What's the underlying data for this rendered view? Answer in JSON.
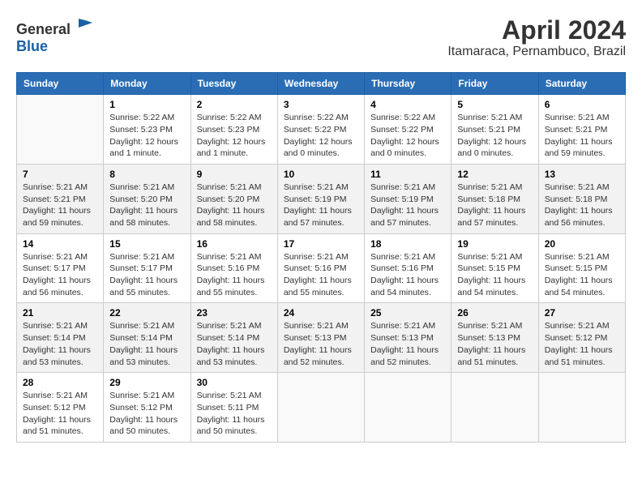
{
  "logo": {
    "general": "General",
    "blue": "Blue"
  },
  "title": "April 2024",
  "subtitle": "Itamaraca, Pernambuco, Brazil",
  "calendar": {
    "headers": [
      "Sunday",
      "Monday",
      "Tuesday",
      "Wednesday",
      "Thursday",
      "Friday",
      "Saturday"
    ],
    "weeks": [
      [
        {
          "day": "",
          "detail": ""
        },
        {
          "day": "1",
          "detail": "Sunrise: 5:22 AM\nSunset: 5:23 PM\nDaylight: 12 hours\nand 1 minute."
        },
        {
          "day": "2",
          "detail": "Sunrise: 5:22 AM\nSunset: 5:23 PM\nDaylight: 12 hours\nand 1 minute."
        },
        {
          "day": "3",
          "detail": "Sunrise: 5:22 AM\nSunset: 5:22 PM\nDaylight: 12 hours\nand 0 minutes."
        },
        {
          "day": "4",
          "detail": "Sunrise: 5:22 AM\nSunset: 5:22 PM\nDaylight: 12 hours\nand 0 minutes."
        },
        {
          "day": "5",
          "detail": "Sunrise: 5:21 AM\nSunset: 5:21 PM\nDaylight: 12 hours\nand 0 minutes."
        },
        {
          "day": "6",
          "detail": "Sunrise: 5:21 AM\nSunset: 5:21 PM\nDaylight: 11 hours\nand 59 minutes."
        }
      ],
      [
        {
          "day": "7",
          "detail": "Sunrise: 5:21 AM\nSunset: 5:21 PM\nDaylight: 11 hours\nand 59 minutes."
        },
        {
          "day": "8",
          "detail": "Sunrise: 5:21 AM\nSunset: 5:20 PM\nDaylight: 11 hours\nand 58 minutes."
        },
        {
          "day": "9",
          "detail": "Sunrise: 5:21 AM\nSunset: 5:20 PM\nDaylight: 11 hours\nand 58 minutes."
        },
        {
          "day": "10",
          "detail": "Sunrise: 5:21 AM\nSunset: 5:19 PM\nDaylight: 11 hours\nand 57 minutes."
        },
        {
          "day": "11",
          "detail": "Sunrise: 5:21 AM\nSunset: 5:19 PM\nDaylight: 11 hours\nand 57 minutes."
        },
        {
          "day": "12",
          "detail": "Sunrise: 5:21 AM\nSunset: 5:18 PM\nDaylight: 11 hours\nand 57 minutes."
        },
        {
          "day": "13",
          "detail": "Sunrise: 5:21 AM\nSunset: 5:18 PM\nDaylight: 11 hours\nand 56 minutes."
        }
      ],
      [
        {
          "day": "14",
          "detail": "Sunrise: 5:21 AM\nSunset: 5:17 PM\nDaylight: 11 hours\nand 56 minutes."
        },
        {
          "day": "15",
          "detail": "Sunrise: 5:21 AM\nSunset: 5:17 PM\nDaylight: 11 hours\nand 55 minutes."
        },
        {
          "day": "16",
          "detail": "Sunrise: 5:21 AM\nSunset: 5:16 PM\nDaylight: 11 hours\nand 55 minutes."
        },
        {
          "day": "17",
          "detail": "Sunrise: 5:21 AM\nSunset: 5:16 PM\nDaylight: 11 hours\nand 55 minutes."
        },
        {
          "day": "18",
          "detail": "Sunrise: 5:21 AM\nSunset: 5:16 PM\nDaylight: 11 hours\nand 54 minutes."
        },
        {
          "day": "19",
          "detail": "Sunrise: 5:21 AM\nSunset: 5:15 PM\nDaylight: 11 hours\nand 54 minutes."
        },
        {
          "day": "20",
          "detail": "Sunrise: 5:21 AM\nSunset: 5:15 PM\nDaylight: 11 hours\nand 54 minutes."
        }
      ],
      [
        {
          "day": "21",
          "detail": "Sunrise: 5:21 AM\nSunset: 5:14 PM\nDaylight: 11 hours\nand 53 minutes."
        },
        {
          "day": "22",
          "detail": "Sunrise: 5:21 AM\nSunset: 5:14 PM\nDaylight: 11 hours\nand 53 minutes."
        },
        {
          "day": "23",
          "detail": "Sunrise: 5:21 AM\nSunset: 5:14 PM\nDaylight: 11 hours\nand 53 minutes."
        },
        {
          "day": "24",
          "detail": "Sunrise: 5:21 AM\nSunset: 5:13 PM\nDaylight: 11 hours\nand 52 minutes."
        },
        {
          "day": "25",
          "detail": "Sunrise: 5:21 AM\nSunset: 5:13 PM\nDaylight: 11 hours\nand 52 minutes."
        },
        {
          "day": "26",
          "detail": "Sunrise: 5:21 AM\nSunset: 5:13 PM\nDaylight: 11 hours\nand 51 minutes."
        },
        {
          "day": "27",
          "detail": "Sunrise: 5:21 AM\nSunset: 5:12 PM\nDaylight: 11 hours\nand 51 minutes."
        }
      ],
      [
        {
          "day": "28",
          "detail": "Sunrise: 5:21 AM\nSunset: 5:12 PM\nDaylight: 11 hours\nand 51 minutes."
        },
        {
          "day": "29",
          "detail": "Sunrise: 5:21 AM\nSunset: 5:12 PM\nDaylight: 11 hours\nand 50 minutes."
        },
        {
          "day": "30",
          "detail": "Sunrise: 5:21 AM\nSunset: 5:11 PM\nDaylight: 11 hours\nand 50 minutes."
        },
        {
          "day": "",
          "detail": ""
        },
        {
          "day": "",
          "detail": ""
        },
        {
          "day": "",
          "detail": ""
        },
        {
          "day": "",
          "detail": ""
        }
      ]
    ]
  }
}
